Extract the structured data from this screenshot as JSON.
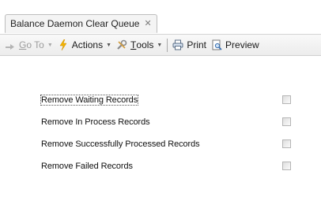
{
  "tab": {
    "title": "Balance Daemon Clear Queue",
    "close_glyph": "✕"
  },
  "toolbar": {
    "goto": {
      "label_underline": "G",
      "label_rest": "o To",
      "icon": "goto-arrow-icon",
      "enabled": false
    },
    "actions": {
      "label": "Actions",
      "icon": "lightning-icon"
    },
    "tools": {
      "label_underline": "T",
      "label_rest": "ools",
      "icon": "wrench-icon"
    },
    "print": {
      "label": "Print",
      "icon": "printer-icon"
    },
    "preview": {
      "label": "Preview",
      "icon": "preview-icon"
    }
  },
  "options": [
    {
      "label": "Remove Waiting Records",
      "checked": false,
      "focused": true
    },
    {
      "label": "Remove In Process Records",
      "checked": false,
      "focused": false
    },
    {
      "label": "Remove Successfully Processed Records",
      "checked": false,
      "focused": false
    },
    {
      "label": "Remove Failed Records",
      "checked": false,
      "focused": false
    }
  ],
  "colors": {
    "accent_lightning": "#f4b400",
    "print_icon": "#3a6fb0"
  }
}
